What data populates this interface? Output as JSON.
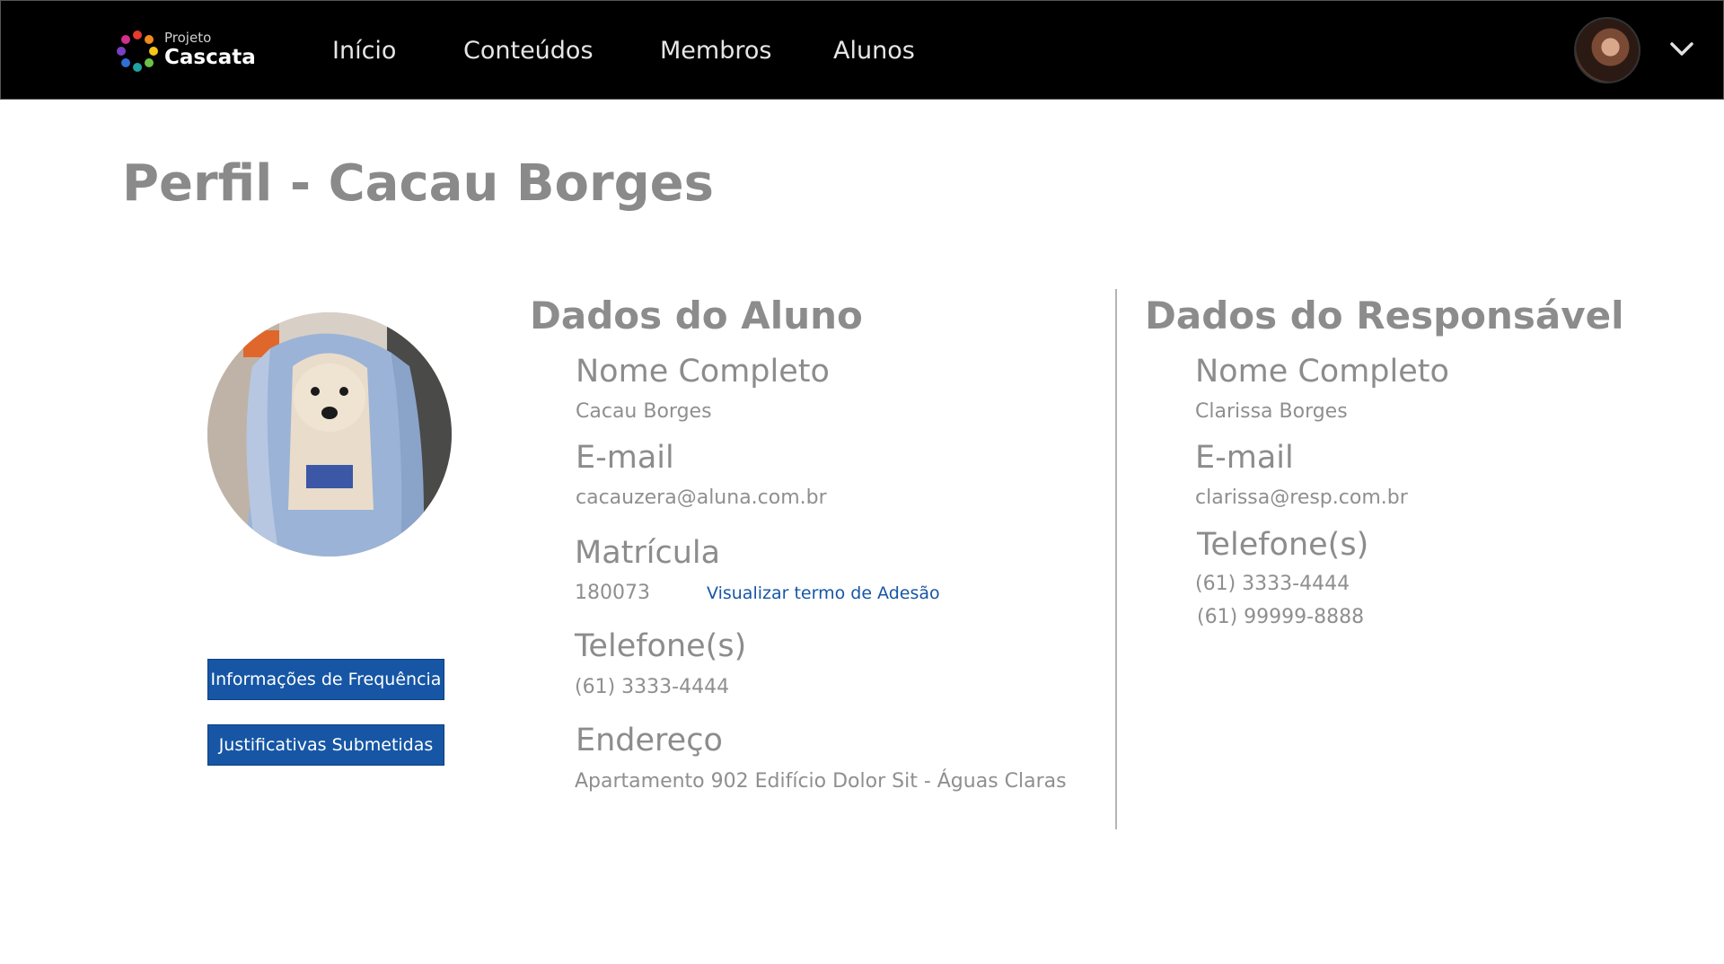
{
  "nav": {
    "logo_small": "Projeto",
    "logo_big": "Cascata",
    "links": [
      "Início",
      "Conteúdos",
      "Membros",
      "Alunos"
    ]
  },
  "page": {
    "title": "Perfil - Cacau Borges"
  },
  "buttons": {
    "frequencia": "Informações de Frequência",
    "justificativas": "Justificativas Submetidas"
  },
  "aluno": {
    "section_title": "Dados do Aluno",
    "nome_label": "Nome Completo",
    "nome_value": "Cacau Borges",
    "email_label": "E-mail",
    "email_value": "cacauzera@aluna.com.br",
    "matricula_label": "Matrícula",
    "matricula_value": "180073",
    "termo_link": "Visualizar termo de Adesão",
    "telefone_label": "Telefone(s)",
    "telefone_value": "(61) 3333-4444",
    "endereco_label": "Endereço",
    "endereco_value": "Apartamento 902 Edifício Dolor Sit - Águas Claras"
  },
  "responsavel": {
    "section_title": "Dados do Responsável",
    "nome_label": "Nome Completo",
    "nome_value": "Clarissa Borges",
    "email_label": "E-mail",
    "email_value": "clarissa@resp.com.br",
    "telefone_label": "Telefone(s)",
    "telefones": [
      "(61) 3333-4444",
      "(61) 99999-8888"
    ]
  },
  "colors": {
    "nav_bg": "#000000",
    "button_bg": "#1656a5",
    "link": "#1656a5",
    "text_gray": "#8c8c8c"
  },
  "icons": [
    "logo-icon",
    "chevron-down-icon"
  ]
}
